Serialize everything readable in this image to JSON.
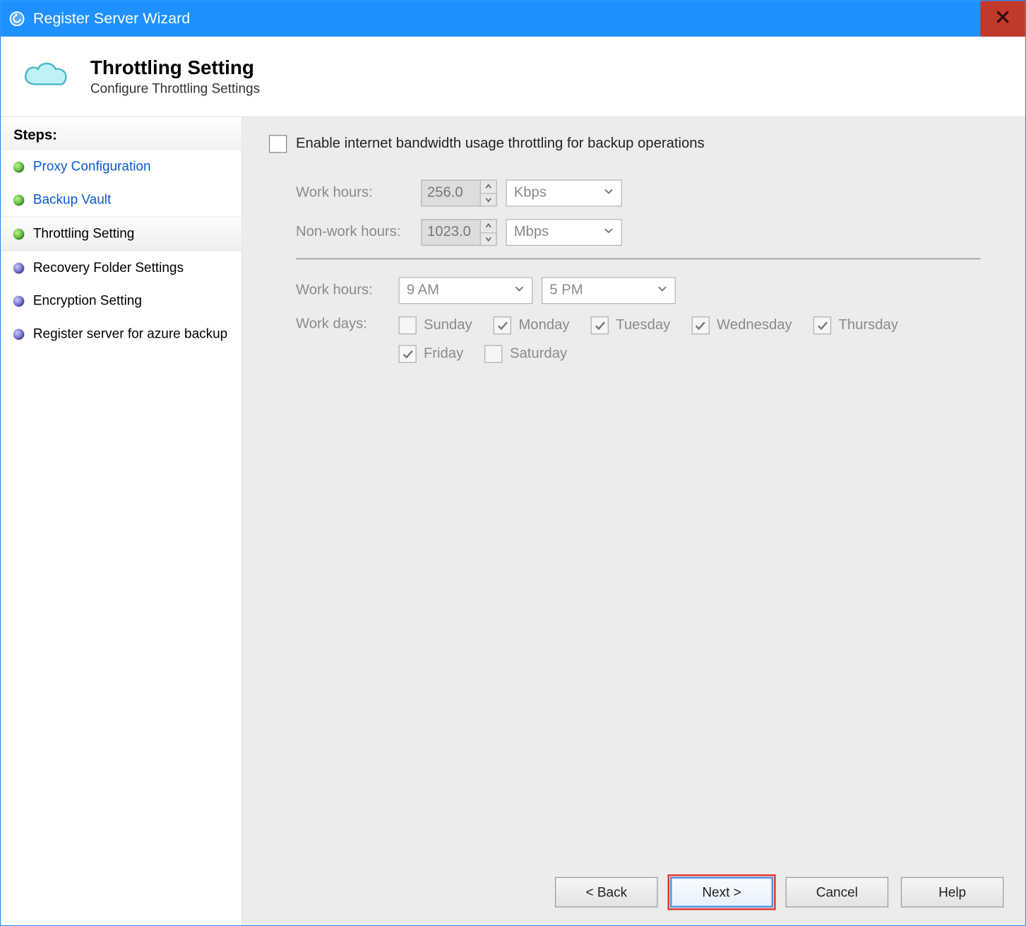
{
  "window": {
    "title": "Register Server Wizard"
  },
  "header": {
    "title": "Throttling Setting",
    "subtitle": "Configure Throttling Settings"
  },
  "sidebar": {
    "label": "Steps:",
    "items": [
      {
        "label": "Proxy Configuration",
        "state": "done"
      },
      {
        "label": "Backup Vault",
        "state": "done"
      },
      {
        "label": "Throttling Setting",
        "state": "current"
      },
      {
        "label": "Recovery Folder Settings",
        "state": "future"
      },
      {
        "label": "Encryption Setting",
        "state": "future"
      },
      {
        "label": "Register server for azure backup",
        "state": "future"
      }
    ]
  },
  "main": {
    "enable_label": "Enable internet bandwidth usage throttling for backup operations",
    "enable_checked": false,
    "work_hours_label": "Work hours:",
    "work_value": "256.0",
    "work_unit": "Kbps",
    "nonwork_hours_label": "Non-work hours:",
    "nonwork_value": "1023.0",
    "nonwork_unit": "Mbps",
    "work_hours2_label": "Work hours:",
    "work_start": "9 AM",
    "work_end": "5 PM",
    "work_days_label": "Work days:",
    "days": [
      {
        "label": "Sunday",
        "checked": false
      },
      {
        "label": "Monday",
        "checked": true
      },
      {
        "label": "Tuesday",
        "checked": true
      },
      {
        "label": "Wednesday",
        "checked": true
      },
      {
        "label": "Thursday",
        "checked": true
      },
      {
        "label": "Friday",
        "checked": true
      },
      {
        "label": "Saturday",
        "checked": false
      }
    ]
  },
  "footer": {
    "back": "< Back",
    "next": "Next >",
    "cancel": "Cancel",
    "help": "Help"
  }
}
